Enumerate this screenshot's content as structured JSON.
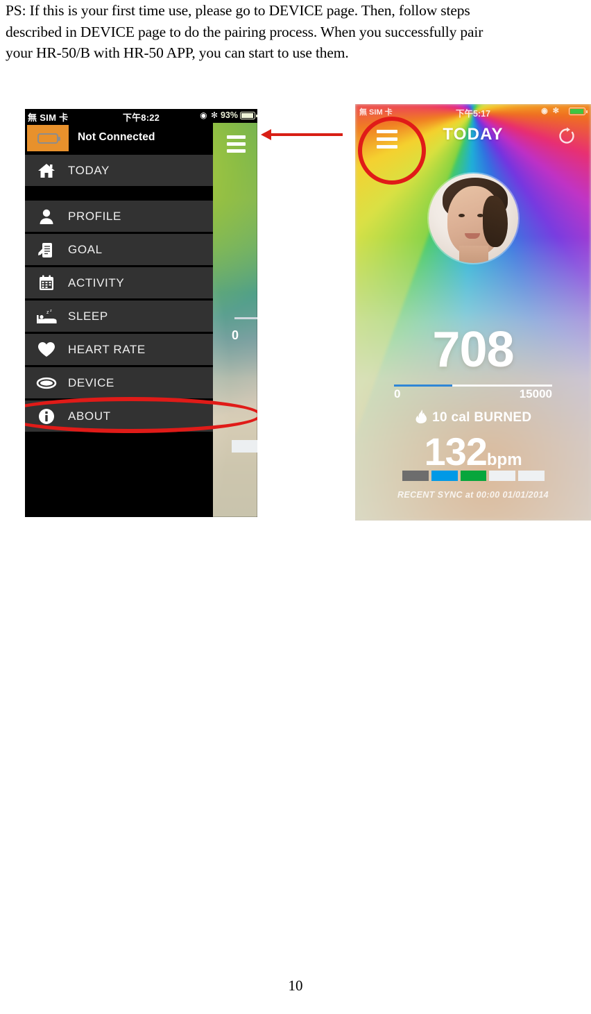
{
  "document": {
    "paragraph_lines": [
      "PS: If this is your first time use, please go to DEVICE page. Then, follow steps",
      "described in DEVICE page to do the pairing process. When you successfully pair",
      "your HR-50/B with HR-50 APP, you can start to use them."
    ],
    "page_number": "10"
  },
  "colors": {
    "annotation_red": "#e01b18",
    "arrow_red": "#d81f15",
    "device_badge_orange": "#e8912c",
    "menu_row": "#323232",
    "progress_blue": "#2f86d6"
  },
  "left_phone": {
    "status_bar": {
      "carrier": "無 SIM 卡",
      "time": "下午8:22",
      "icons": "◉ ✻",
      "battery_percent": "93%"
    },
    "drawer": {
      "connection_status": "Not Connected",
      "device_icon": "battery-icon",
      "items": [
        {
          "label": "TODAY",
          "icon": "home-icon"
        },
        {
          "label": "PROFILE",
          "icon": "person-icon"
        },
        {
          "label": "GOAL",
          "icon": "goal-document-icon"
        },
        {
          "label": "ACTIVITY",
          "icon": "calendar-icon"
        },
        {
          "label": "SLEEP",
          "icon": "bed-icon"
        },
        {
          "label": "HEART RATE",
          "icon": "heart-icon"
        },
        {
          "label": "DEVICE",
          "icon": "wristband-icon"
        },
        {
          "label": "ABOUT",
          "icon": "info-icon"
        }
      ]
    },
    "background_screen": {
      "menu_icon": "hamburger-icon",
      "partial_zero": "0"
    },
    "annotation": {
      "highlighted_item": "DEVICE",
      "shape": "red-ellipse"
    }
  },
  "right_phone": {
    "status_bar": {
      "carrier": "無 SIM 卡",
      "time": "下午5:17",
      "icons": "◉ ✻"
    },
    "header": {
      "menu_icon": "hamburger-icon",
      "title": "TODAY",
      "refresh_icon": "refresh-icon"
    },
    "avatar": "user-avatar",
    "steps": {
      "value": "708",
      "min": "0",
      "max": "15000",
      "progress_percent": 37
    },
    "calories": {
      "icon": "flame-icon",
      "text": "10 cal BURNED"
    },
    "heart_rate": {
      "value": "132",
      "unit": "bpm",
      "zone_colors": [
        "#6d6d6d",
        "#0099e6",
        "#07a63c",
        "#eef1f3",
        "#eef1f3"
      ]
    },
    "sync": "RECENT SYNC at 00:00 01/01/2014",
    "annotation": {
      "highlighted_item": "hamburger-icon",
      "shape": "red-circle",
      "arrow": "left-pointing-arrow"
    }
  }
}
